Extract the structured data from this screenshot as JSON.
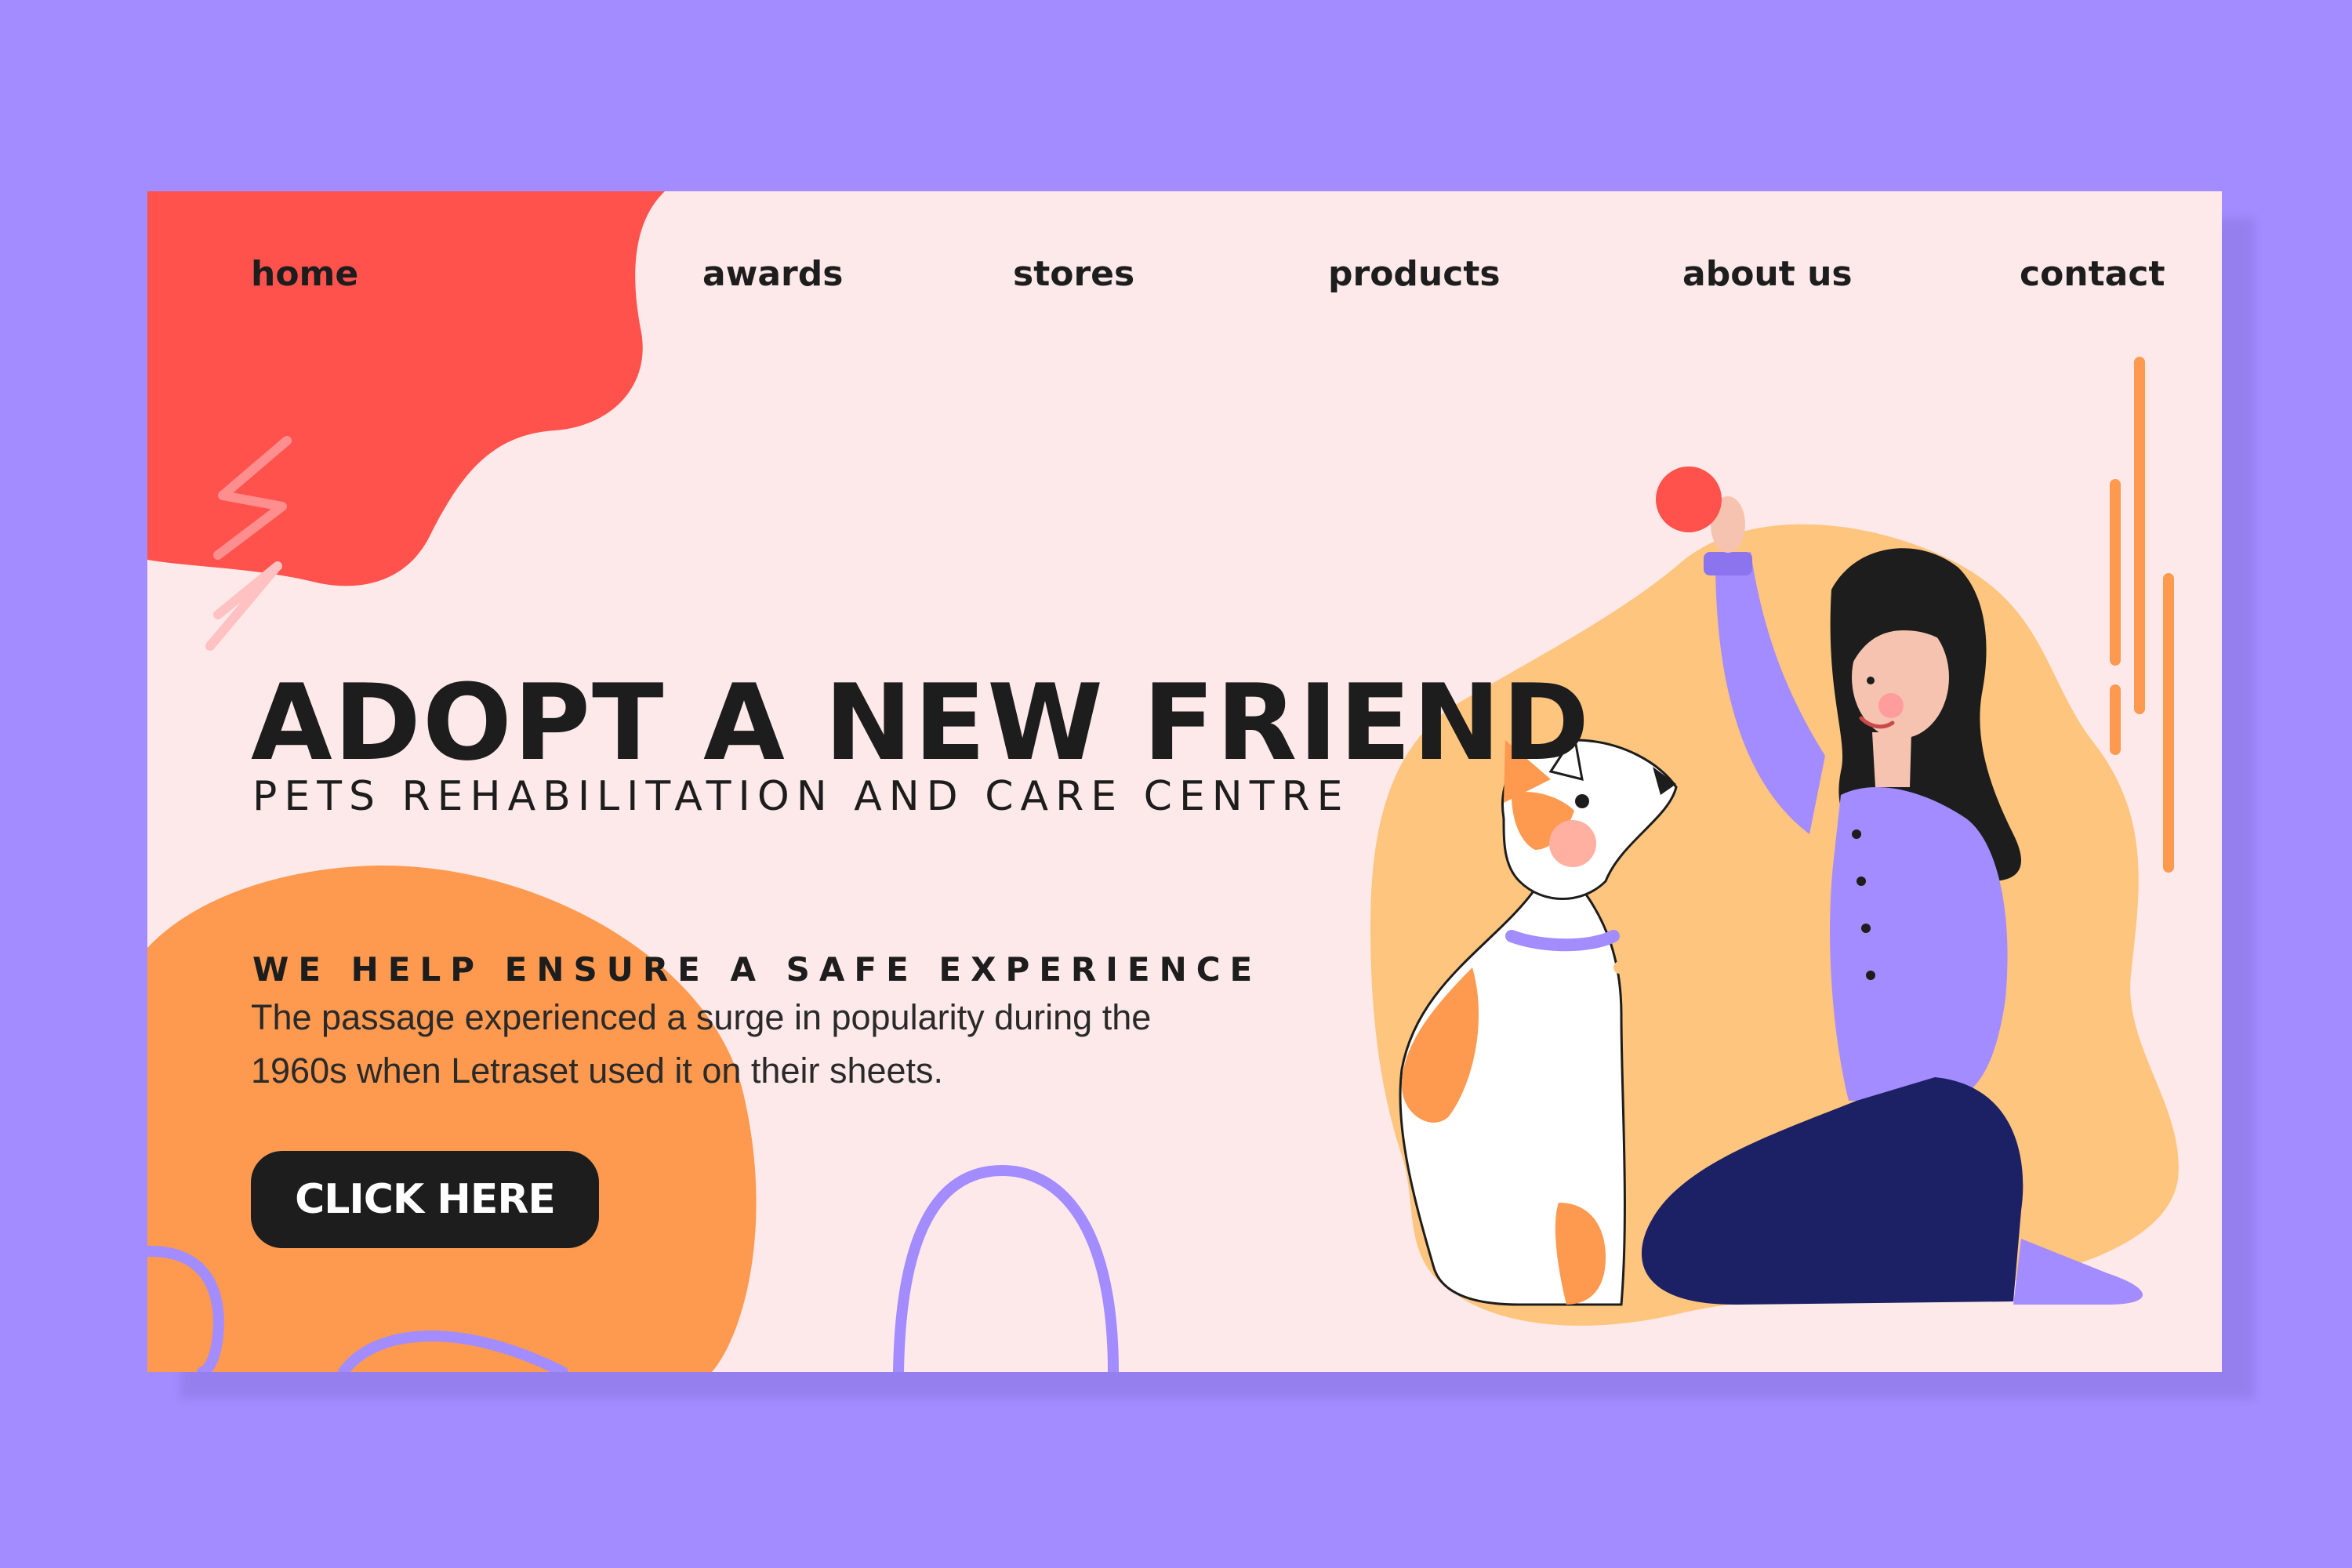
{
  "nav": {
    "items": [
      {
        "label": "home"
      },
      {
        "label": "awards"
      },
      {
        "label": "stores"
      },
      {
        "label": "products"
      },
      {
        "label": "about us"
      },
      {
        "label": "contact"
      }
    ]
  },
  "hero": {
    "headline": "ADOPT A NEW FRIEND",
    "subline": "PETS REHABILITATION AND CARE CENTRE",
    "tagline": "WE HELP ENSURE A SAFE EXPERIENCE",
    "body_lines": [
      "The passage experienced a surge in popularity during the",
      "1960s when Letraset used it on their sheets."
    ],
    "cta_label": "CLICK HERE"
  },
  "colors": {
    "page_background": "#a38cff",
    "card_background": "#fde9e9",
    "coral_blob": "#ff524d",
    "orange_blob": "#fd9a50",
    "yellow_blob": "#fdc57d",
    "purple_accent": "#a38cff",
    "button": "#1d1d1d",
    "text": "#1d1d1d"
  }
}
